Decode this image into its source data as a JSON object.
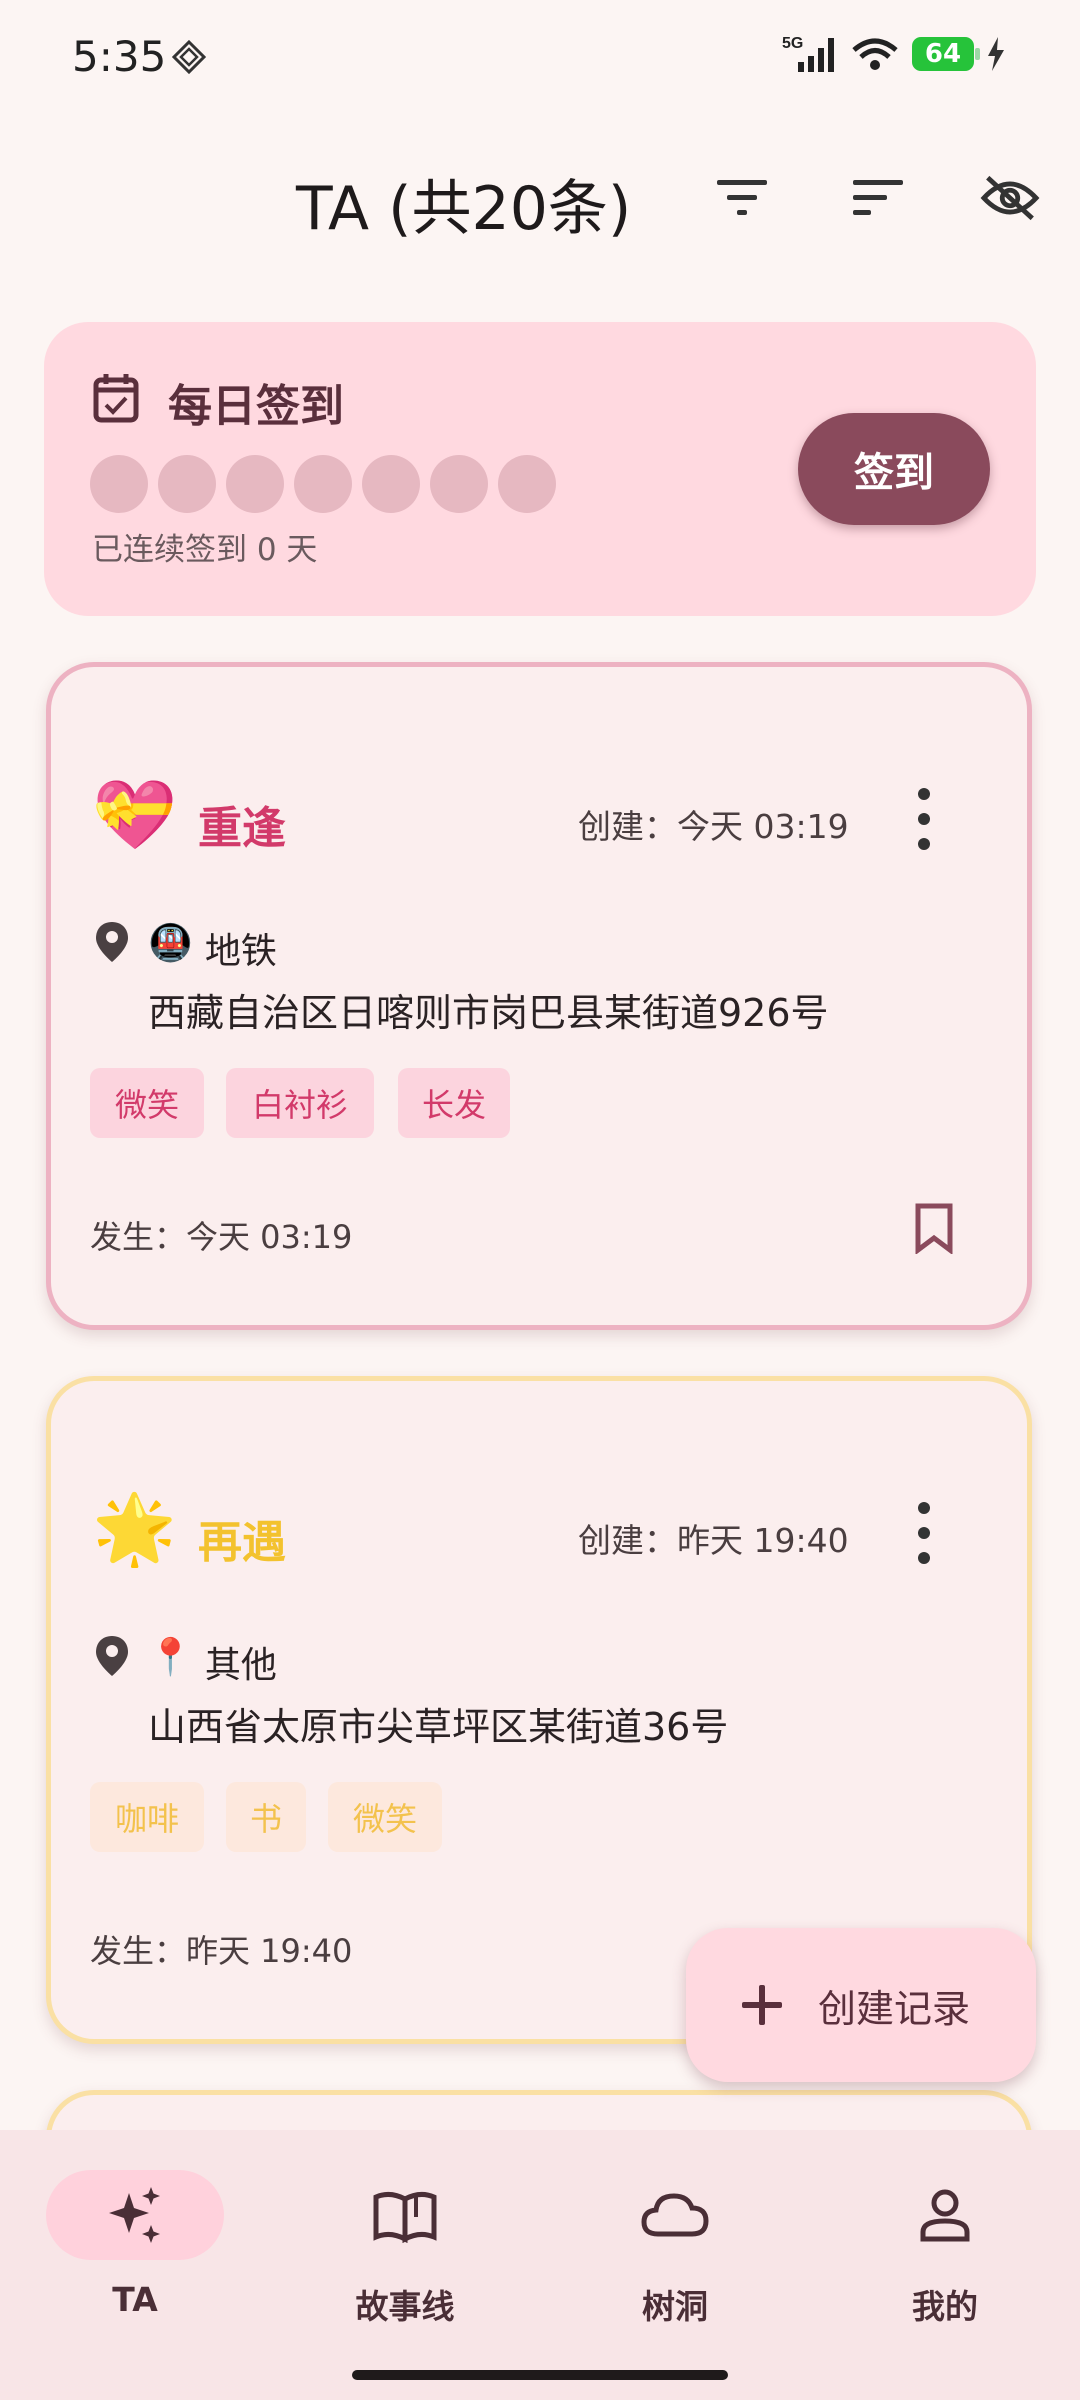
{
  "status_bar": {
    "time": "5:35",
    "network": "5G",
    "battery": "64"
  },
  "app_bar": {
    "title": "TA (共20条)",
    "icons": [
      "filter-icon",
      "sort-icon",
      "visibility-off-icon"
    ]
  },
  "checkin": {
    "title": "每日签到",
    "streak_text": "已连续签到 0 天",
    "button_label": "签到",
    "days_total": 7,
    "days_checked": 0
  },
  "records": [
    {
      "emoji": "💝",
      "title": "重逢",
      "title_color": "#D23A6A",
      "created": "创建：今天 03:19",
      "location_emoji": "🚇",
      "location_type": "地铁",
      "address": "西藏自治区日喀则市岗巴县某街道926号",
      "tags": [
        "微笑",
        "白衬衫",
        "长发"
      ],
      "occurred": "发生：今天 03:19"
    },
    {
      "emoji": "🌟",
      "title": "再遇",
      "title_color": "#F3C22E",
      "created": "创建：昨天 19:40",
      "location_emoji": "📍",
      "location_type": "其他",
      "address": "山西省太原市尖草坪区某街道36号",
      "tags": [
        "咖啡",
        "书",
        "微笑"
      ],
      "occurred": "发生：昨天 19:40"
    }
  ],
  "fab": {
    "label": "创建记录"
  },
  "bottom_nav": [
    {
      "label": "TA",
      "icon": "sparkle-icon",
      "active": true
    },
    {
      "label": "故事线",
      "icon": "book-icon",
      "active": false
    },
    {
      "label": "树洞",
      "icon": "cloud-icon",
      "active": false
    },
    {
      "label": "我的",
      "icon": "person-icon",
      "active": false
    }
  ]
}
